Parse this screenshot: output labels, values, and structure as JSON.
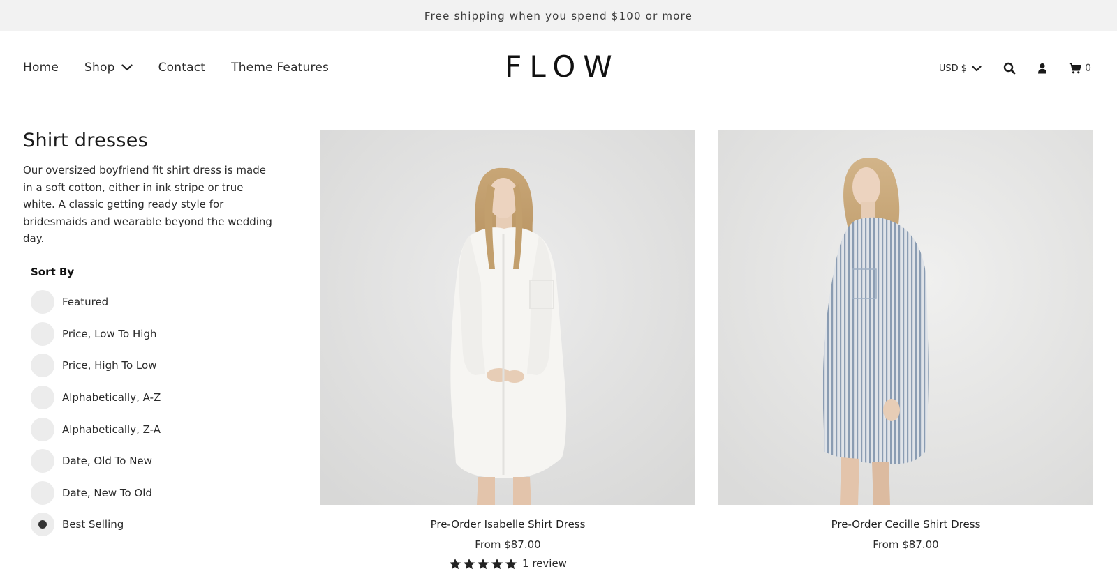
{
  "announcement": "Free shipping when you spend $100 or more",
  "nav": {
    "items": [
      {
        "label": "Home"
      },
      {
        "label": "Shop"
      },
      {
        "label": "Contact"
      },
      {
        "label": "Theme Features"
      }
    ]
  },
  "logo": "FLOW",
  "tools": {
    "currency": "USD $",
    "cart_count": "0",
    "icons": [
      "search-icon",
      "account-icon",
      "cart-icon"
    ]
  },
  "collection": {
    "title": "Shirt dresses",
    "description": "Our oversized boyfriend fit shirt dress is made in a soft cotton, either in ink stripe or true white. A classic getting ready style for bridesmaids and wearable beyond the wedding day."
  },
  "sort": {
    "heading": "Sort By",
    "selected": "Best Selling",
    "options": [
      {
        "label": "Featured"
      },
      {
        "label": "Price, Low To High"
      },
      {
        "label": "Price, High To Low"
      },
      {
        "label": "Alphabetically, A-Z"
      },
      {
        "label": "Alphabetically, Z-A"
      },
      {
        "label": "Date, Old To New"
      },
      {
        "label": "Date, New To Old"
      },
      {
        "label": "Best Selling"
      }
    ]
  },
  "products": [
    {
      "name": "Pre-Order Isabelle Shirt Dress",
      "price": "From $87.00",
      "rating": 5,
      "reviews": "1 review"
    },
    {
      "name": "Pre-Order Cecille Shirt Dress",
      "price": "From $87.00"
    }
  ],
  "colors": {
    "announcement_bg": "#f2f2f2",
    "radio_bg": "#ececec",
    "text": "#1a1a1a"
  }
}
